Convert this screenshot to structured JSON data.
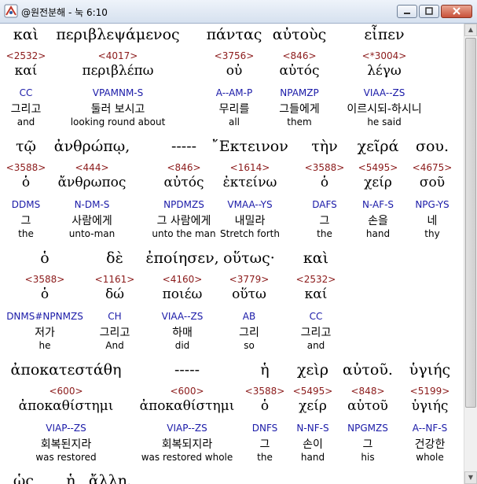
{
  "window": {
    "title": "@원전분해 - 눅 6:10"
  },
  "rows": [
    {
      "words": [
        {
          "greek": "καὶ",
          "num": "<2532>",
          "lemma": "καί",
          "parse": "CC",
          "korean": "그리고",
          "english": "and"
        },
        {
          "greek": "περιβλεψάμενος",
          "num": "<4017>",
          "lemma": "περιβλέπω",
          "parse": "VPAMNM-S",
          "korean": "둘러 보시고",
          "english": "looking round about"
        },
        {
          "greek": "πάντας",
          "num": "<3756>",
          "lemma": "οὐ",
          "parse": "A--AM-P",
          "korean": "무리를",
          "english": "all"
        },
        {
          "greek": "αὐτοὺς",
          "num": "<846>",
          "lemma": "αὐτός",
          "parse": "NPAMZP",
          "korean": "그들에게",
          "english": "them"
        },
        {
          "greek": "εἶπεν",
          "num": "<*3004>",
          "lemma": "λέγω",
          "parse": "VIAA--ZS",
          "korean": "이르시되-하시니",
          "english": "he said"
        }
      ]
    },
    {
      "words": [
        {
          "greek": "τῷ",
          "num": "<3588>",
          "lemma": "ὁ",
          "parse": "DDMS",
          "korean": "그",
          "english": "the"
        },
        {
          "greek": "ἀνθρώπῳ,",
          "num": "<444>",
          "lemma": "ἄνθρωπος",
          "parse": "N-DM-S",
          "korean": "사람에게",
          "english": "unto-man"
        },
        {
          "greek": "-----",
          "num": "<846>",
          "lemma": "αὐτός",
          "parse": "NPDMZS",
          "korean": "그 사람에게",
          "english": "unto the man"
        },
        {
          "greek": "῎Εκτεινον",
          "num": "<1614>",
          "lemma": "ἐκτείνω",
          "parse": "VMAA--YS",
          "korean": "내밀라",
          "english": "Stretch forth"
        },
        {
          "greek": "τὴν",
          "num": "<3588>",
          "lemma": "ὁ",
          "parse": "DAFS",
          "korean": "그",
          "english": "the"
        },
        {
          "greek": "χεῖρά",
          "num": "<5495>",
          "lemma": "χείρ",
          "parse": "N-AF-S",
          "korean": "손을",
          "english": "hand"
        },
        {
          "greek": "σου.",
          "num": "<4675>",
          "lemma": "σοῦ",
          "parse": "NPG-YS",
          "korean": "네",
          "english": "thy"
        }
      ]
    },
    {
      "words": [
        {
          "greek": "ὁ",
          "num": "<3588>",
          "lemma": "ὁ",
          "parse": "DNMS#NPNMZS",
          "korean": "저가",
          "english": "he"
        },
        {
          "greek": "δὲ",
          "num": "<1161>",
          "lemma": "δώ",
          "parse": "CH",
          "korean": "그리고",
          "english": "And"
        },
        {
          "greek": "ἐποίησεν,",
          "num": "<4160>",
          "lemma": "ποιέω",
          "parse": "VIAA--ZS",
          "korean": "하매",
          "english": "did"
        },
        {
          "greek": "οὕτως·",
          "num": "<3779>",
          "lemma": "οὕτω",
          "parse": "AB",
          "korean": "그리",
          "english": "so"
        },
        {
          "greek": "καὶ",
          "num": "<2532>",
          "lemma": "καί",
          "parse": "CC",
          "korean": "그리고",
          "english": "and"
        }
      ]
    },
    {
      "words": [
        {
          "greek": "ἀποκατεστάθη",
          "num": "<600>",
          "lemma": "ἀποκαθίστημι",
          "parse": "VIAP--ZS",
          "korean": "회복된지라",
          "english": "was restored"
        },
        {
          "greek": "-----",
          "num": "<600>",
          "lemma": "ἀποκαθίστημι",
          "parse": "VIAP--ZS",
          "korean": "회복되지라",
          "english": "was restored whole"
        },
        {
          "greek": "ἡ",
          "num": "<3588>",
          "lemma": "ὁ",
          "parse": "DNFS",
          "korean": "그",
          "english": "the"
        },
        {
          "greek": "χεὶρ",
          "num": "<5495>",
          "lemma": "χείρ",
          "parse": "N-NF-S",
          "korean": "손이",
          "english": "hand"
        },
        {
          "greek": "αὐτοῦ.",
          "num": "<848>",
          "lemma": "αὑτοῦ",
          "parse": "NPGMZS",
          "korean": "그",
          "english": "his"
        },
        {
          "greek": "ὑγιής",
          "num": "<5199>",
          "lemma": "ὑγιής",
          "parse": "A--NF-S",
          "korean": "건강한",
          "english": "whole"
        }
      ]
    },
    {
      "words": [
        {
          "greek": "ὡς",
          "num": "",
          "lemma": "",
          "parse": "",
          "korean": "",
          "english": ""
        },
        {
          "greek": "ἡ",
          "num": "",
          "lemma": "",
          "parse": "",
          "korean": "",
          "english": ""
        },
        {
          "greek": "ἄλλη.",
          "num": "",
          "lemma": "",
          "parse": "",
          "korean": "",
          "english": ""
        }
      ]
    }
  ],
  "colors": {
    "strongs": "#8b1a1a",
    "parsing": "#1a1aa8",
    "titlebar": "#d6e1ef"
  },
  "icons": {
    "app": "app-icon",
    "minimize": "minimize-icon",
    "maximize": "maximize-icon",
    "close": "close-icon"
  }
}
